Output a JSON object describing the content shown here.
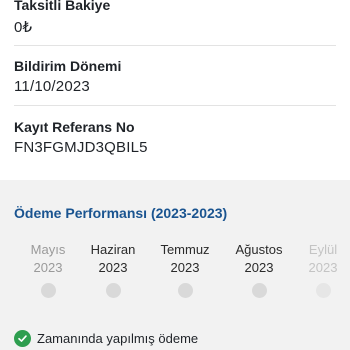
{
  "balance": {
    "label": "Taksitli Bakiye",
    "value": "0₺"
  },
  "statement": {
    "label": "Bildirim Dönemi",
    "value": "11/10/2023"
  },
  "reference": {
    "label": "Kayıt Referans No",
    "value": "FN3FGMJD3QBIL5"
  },
  "performance": {
    "title": "Ödeme Performansı (2023-2023)",
    "months": [
      {
        "month": "Mayıs",
        "year": "2023"
      },
      {
        "month": "Haziran",
        "year": "2023"
      },
      {
        "month": "Temmuz",
        "year": "2023"
      },
      {
        "month": "Ağustos",
        "year": "2023"
      },
      {
        "month": "Eylül",
        "year": "2023"
      }
    ],
    "legend": {
      "label": "Zamanında yapılmış ödeme",
      "color": "#2e9e4f",
      "icon": "check-circle-icon"
    },
    "title_color": "#1a5490"
  }
}
